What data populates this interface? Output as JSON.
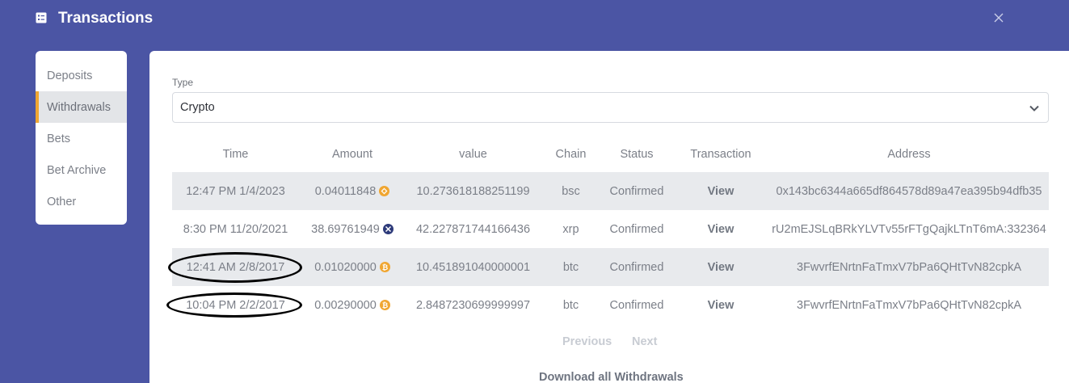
{
  "header": {
    "title": "Transactions",
    "icon": "receipt-icon",
    "close_icon": "close-icon"
  },
  "sidebar": {
    "items": [
      {
        "label": "Deposits",
        "active": false
      },
      {
        "label": "Withdrawals",
        "active": true
      },
      {
        "label": "Bets",
        "active": false
      },
      {
        "label": "Bet Archive",
        "active": false
      },
      {
        "label": "Other",
        "active": false
      }
    ],
    "accent_color": "#f0a631"
  },
  "filter": {
    "label": "Type",
    "selected": "Crypto"
  },
  "table": {
    "columns": [
      "Time",
      "Amount",
      "value",
      "Chain",
      "Status",
      "Transaction",
      "Address"
    ],
    "rows": [
      {
        "time": "12:47 PM 1/4/2023",
        "amount": "0.04011848",
        "coin": "bnb-icon",
        "value": "10.273618188251199",
        "chain": "bsc",
        "status": "Confirmed",
        "transaction": "View",
        "address": "0x143bc6344a665df864578d89a47ea395b94dfb35"
      },
      {
        "time": "8:30 PM 11/20/2021",
        "amount": "38.69761949",
        "coin": "xrp-icon",
        "value": "42.227871744166436",
        "chain": "xrp",
        "status": "Confirmed",
        "transaction": "View",
        "address": "rU2mEJSLqBRkYLVTv55rFTgQajkLTnT6mA:332364"
      },
      {
        "time": "12:41 AM 2/8/2017",
        "amount": "0.01020000",
        "coin": "bitcoin-icon",
        "value": "10.451891040000001",
        "chain": "btc",
        "status": "Confirmed",
        "transaction": "View",
        "address": "3FwvrfENrtnFaTmxV7bPa6QHtTvN82cpkA"
      },
      {
        "time": "10:04 PM 2/2/2017",
        "amount": "0.00290000",
        "coin": "bitcoin-icon",
        "value": "2.8487230699999997",
        "chain": "btc",
        "status": "Confirmed",
        "transaction": "View",
        "address": "3FwvrfENrtnFaTmxV7bPa6QHtTvN82cpkA"
      }
    ]
  },
  "pagination": {
    "previous": "Previous",
    "next": "Next"
  },
  "download_label": "Download all Withdrawals",
  "colors": {
    "background": "#4b55a4",
    "coin_orange": "#f0a631",
    "xrp_navy": "#2d3a7a",
    "annotation": "#000000"
  }
}
